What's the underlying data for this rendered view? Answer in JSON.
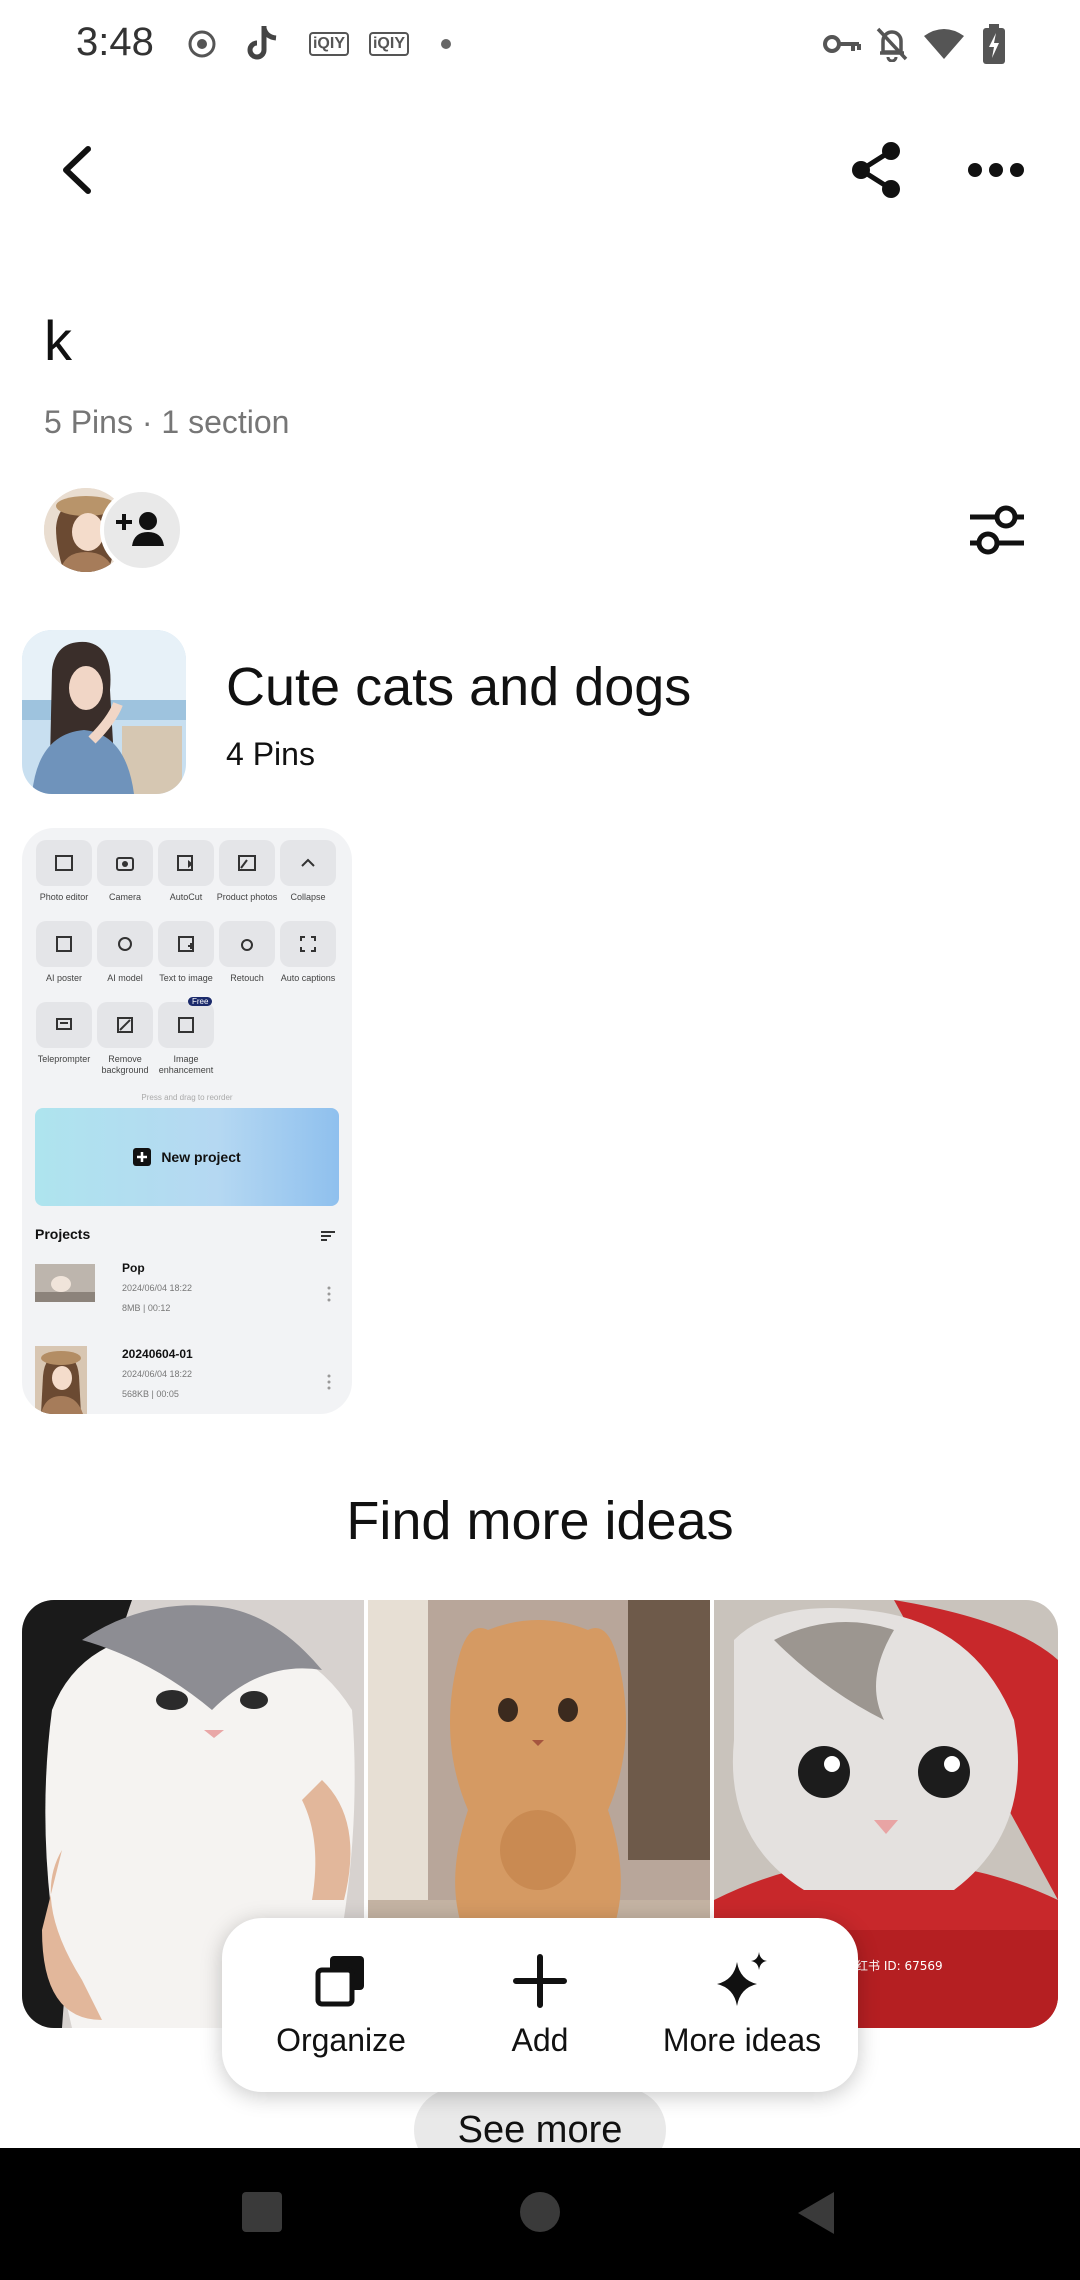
{
  "status_bar": {
    "time": "3:48",
    "icons_left": [
      "record-icon",
      "tiktok-icon",
      "iqiyi-icon",
      "iqiyi-icon",
      "dot-icon"
    ],
    "iqiyi_label": "iQIY",
    "icons_right": [
      "key-icon",
      "bell-off-icon",
      "wifi-icon",
      "battery-charging-icon"
    ]
  },
  "header": {
    "back_icon": "chevron-left-icon",
    "share_icon": "share-icon",
    "more_icon": "more-horizontal-icon"
  },
  "board": {
    "title": "k",
    "meta": "5 Pins · 1 section"
  },
  "collaborators": {
    "add_icon": "add-person-icon",
    "filter_icon": "sliders-icon"
  },
  "section": {
    "title": "Cute cats and dogs",
    "count": "4 Pins"
  },
  "pin": {
    "tools": [
      {
        "label": "Photo editor"
      },
      {
        "label": "Camera"
      },
      {
        "label": "AutoCut"
      },
      {
        "label": "Product photos"
      },
      {
        "label": "Collapse"
      },
      {
        "label": "AI poster"
      },
      {
        "label": "AI model"
      },
      {
        "label": "Text to image"
      },
      {
        "label": "Retouch"
      },
      {
        "label": "Auto captions"
      },
      {
        "label": "Teleprompter"
      },
      {
        "label": "Remove background"
      },
      {
        "label": "Image enhancement"
      }
    ],
    "free_badge": "Free",
    "reorder_hint": "Press and drag to reorder",
    "new_project": "New project",
    "projects_heading": "Projects",
    "projects": [
      {
        "name": "Pop",
        "date": "2024/06/04 18:22",
        "meta": "8MB  |  00:12"
      },
      {
        "name": "20240604-01",
        "date": "2024/06/04 18:22",
        "meta": "568KB  |  00:05"
      }
    ]
  },
  "find_more": {
    "title": "Find more ideas",
    "watermark": "小红书 ID: 67569"
  },
  "actions": {
    "organize": "Organize",
    "add": "Add",
    "more_ideas": "More ideas"
  },
  "see_more": "See more",
  "nav_bar": {
    "icons": [
      "recents-square-icon",
      "home-circle-icon",
      "back-triangle-icon"
    ]
  }
}
